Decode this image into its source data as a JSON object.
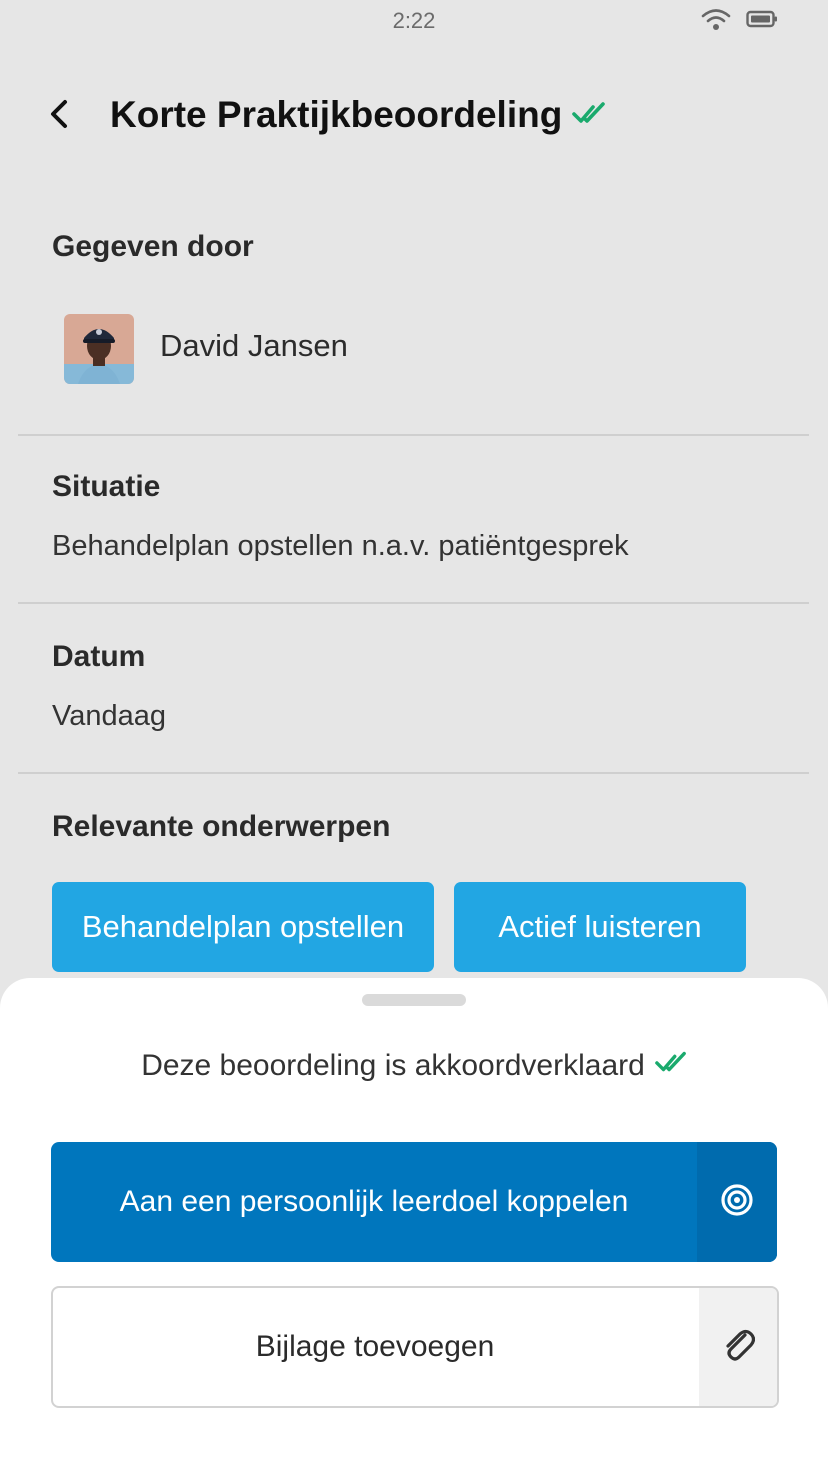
{
  "status_bar": {
    "time": "2:22"
  },
  "header": {
    "title": "Korte Praktijkbeoordeling"
  },
  "given_by": {
    "label": "Gegeven door",
    "name": "David Jansen"
  },
  "situation": {
    "label": "Situatie",
    "value": "Behandelplan opstellen n.a.v. patiëntgesprek"
  },
  "date": {
    "label": "Datum",
    "value": "Vandaag"
  },
  "topics": {
    "label": "Relevante onderwerpen",
    "items": [
      {
        "label": "Behandelplan opstellen"
      },
      {
        "label": "Actief luisteren"
      }
    ]
  },
  "sheet": {
    "approved_text": "Deze beoordeling is akkoordverklaard",
    "primary_button": "Aan een persoonlijk leerdoel koppelen",
    "secondary_button": "Bijlage toevoegen"
  },
  "colors": {
    "accent": "#0076bd",
    "chip": "#22a6e3",
    "check": "#1aaa6d"
  }
}
